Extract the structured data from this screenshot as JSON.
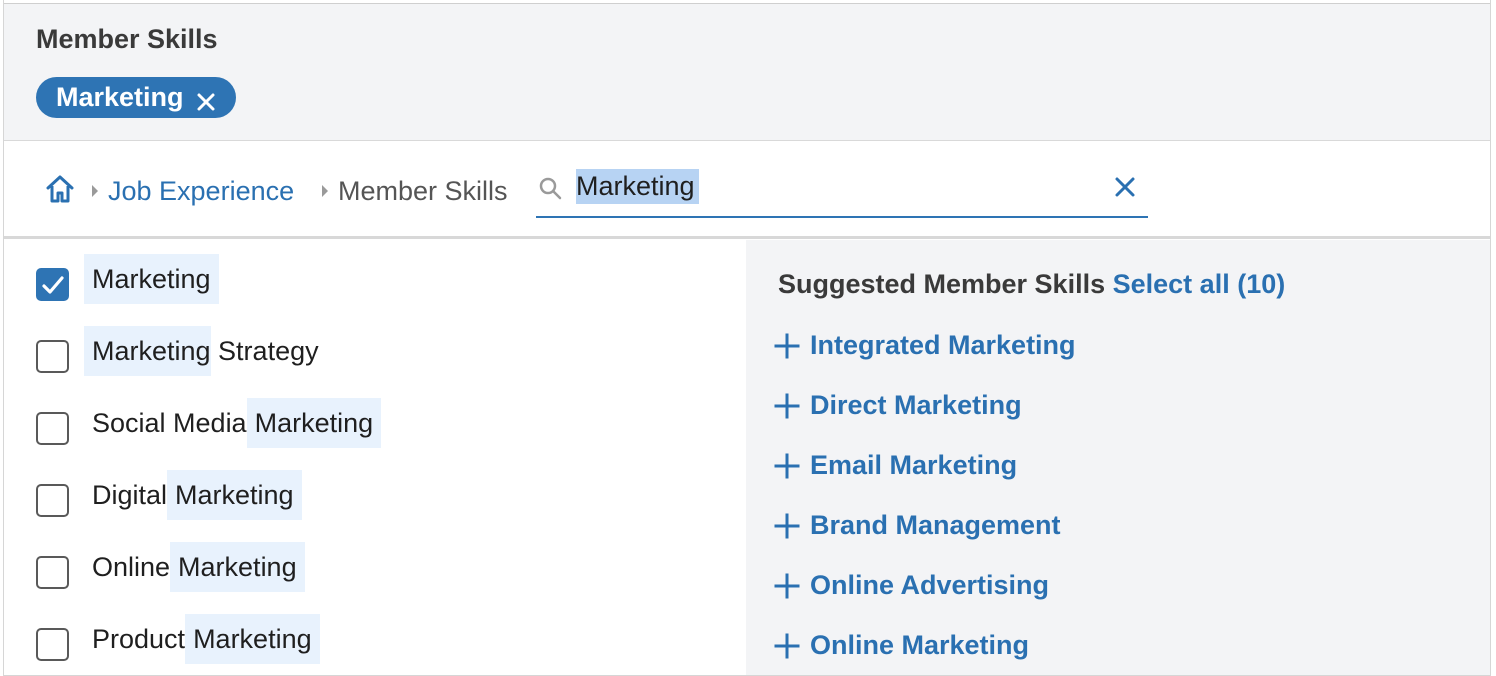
{
  "header": {
    "title": "Member Skills",
    "selected_pill": "Marketing"
  },
  "breadcrumb": {
    "link": "Job Experience",
    "current": "Member Skills"
  },
  "search": {
    "value": "Marketing"
  },
  "results": [
    {
      "pre": "",
      "hl": "Marketing",
      "post": "",
      "checked": true
    },
    {
      "pre": "",
      "hl": "Marketing",
      "post": " Strategy",
      "checked": false
    },
    {
      "pre": "Social Media",
      "hl": "Marketing",
      "post": "",
      "checked": false
    },
    {
      "pre": "Digital",
      "hl": "Marketing",
      "post": "",
      "checked": false
    },
    {
      "pre": "Online",
      "hl": "Marketing",
      "post": "",
      "checked": false
    },
    {
      "pre": "Product",
      "hl": "Marketing",
      "post": "",
      "checked": false
    }
  ],
  "suggestions": {
    "title": "Suggested Member Skills",
    "select_all": "Select all (10)",
    "items": [
      "Integrated Marketing",
      "Direct Marketing",
      "Email Marketing",
      "Brand Management",
      "Online Advertising",
      "Online Marketing"
    ]
  },
  "colors": {
    "accent": "#2e74b4",
    "link": "#2a70b1",
    "highlight": "#e8f2fd",
    "panel": "#f3f4f6"
  }
}
